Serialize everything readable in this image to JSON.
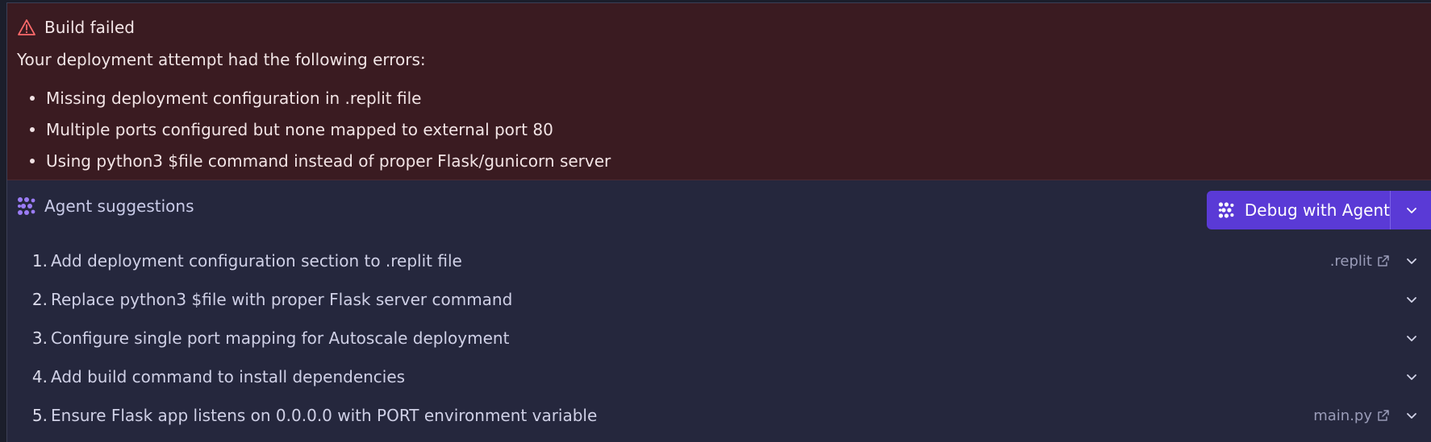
{
  "error": {
    "title": "Build failed",
    "description": "Your deployment attempt had the following errors:",
    "items": [
      "Missing deployment configuration in .replit file",
      "Multiple ports configured but none mapped to external port 80",
      "Using python3 $file command instead of proper Flask/gunicorn server"
    ],
    "icon": "warning-triangle-icon"
  },
  "agent": {
    "title": "Agent suggestions",
    "icon": "agent-icon",
    "debug_button_label": "Debug with Agent"
  },
  "suggestions": [
    {
      "num": "1.",
      "text": "Add deployment configuration section to .replit file",
      "file": ".replit"
    },
    {
      "num": "2.",
      "text": "Replace python3 $file with proper Flask server command",
      "file": ""
    },
    {
      "num": "3.",
      "text": "Configure single port mapping for Autoscale deployment",
      "file": ""
    },
    {
      "num": "4.",
      "text": "Add build command to install dependencies",
      "file": ""
    },
    {
      "num": "5.",
      "text": "Ensure Flask app listens on 0.0.0.0 with PORT environment variable",
      "file": "main.py"
    }
  ],
  "colors": {
    "error_bg": "#3a1b21",
    "panel_bg": "#25273d",
    "accent": "#5a3ad6",
    "warning": "#ff6b6b",
    "agent_icon": "#9b7cf5"
  }
}
